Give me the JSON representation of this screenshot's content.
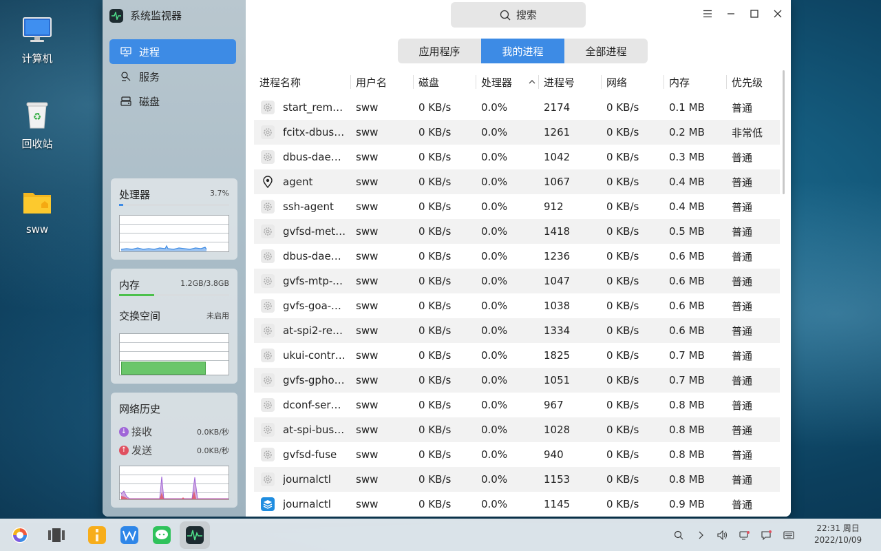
{
  "desktop": {
    "icons": [
      {
        "label": "计算机"
      },
      {
        "label": "回收站"
      },
      {
        "label": "sww"
      }
    ]
  },
  "window": {
    "title": "系统监视器",
    "search_placeholder": "搜索",
    "nav": [
      {
        "label": "进程",
        "active": true
      },
      {
        "label": "服务",
        "active": false
      },
      {
        "label": "磁盘",
        "active": false
      }
    ],
    "cpu_card": {
      "title": "处理器",
      "value": "3.7%",
      "level": 0.037
    },
    "mem_card": {
      "title": "内存",
      "value": "1.2GB/3.8GB",
      "level": 0.32,
      "swap_title": "交换空间",
      "swap_value": "未启用"
    },
    "net_card": {
      "title": "网络历史",
      "recv_label": "接收",
      "recv_value": "0.0KB/秒",
      "send_label": "发送",
      "send_value": "0.0KB/秒"
    },
    "tabs": [
      {
        "label": "应用程序",
        "active": false
      },
      {
        "label": "我的进程",
        "active": true
      },
      {
        "label": "全部进程",
        "active": false
      }
    ],
    "columns": [
      "进程名称",
      "用户名",
      "磁盘",
      "处理器",
      "进程号",
      "网络",
      "内存",
      "优先级"
    ],
    "sort_column": "处理器",
    "processes": [
      {
        "name": "start_remo…",
        "icon": "gear-icon",
        "user": "sww",
        "disk": "0 KB/s",
        "cpu": "0.0%",
        "pid": "2174",
        "net": "0 KB/s",
        "mem": "0.1 MB",
        "priority": "普通"
      },
      {
        "name": "fcitx-dbus-…",
        "icon": "gear-icon",
        "user": "sww",
        "disk": "0 KB/s",
        "cpu": "0.0%",
        "pid": "1261",
        "net": "0 KB/s",
        "mem": "0.2 MB",
        "priority": "非常低"
      },
      {
        "name": "dbus-dae…",
        "icon": "gear-icon",
        "user": "sww",
        "disk": "0 KB/s",
        "cpu": "0.0%",
        "pid": "1042",
        "net": "0 KB/s",
        "mem": "0.3 MB",
        "priority": "普通"
      },
      {
        "name": "agent",
        "icon": "location-pin-icon",
        "user": "sww",
        "disk": "0 KB/s",
        "cpu": "0.0%",
        "pid": "1067",
        "net": "0 KB/s",
        "mem": "0.4 MB",
        "priority": "普通"
      },
      {
        "name": "ssh-agent",
        "icon": "gear-icon",
        "user": "sww",
        "disk": "0 KB/s",
        "cpu": "0.0%",
        "pid": "912",
        "net": "0 KB/s",
        "mem": "0.4 MB",
        "priority": "普通"
      },
      {
        "name": "gvfsd-met…",
        "icon": "gear-icon",
        "user": "sww",
        "disk": "0 KB/s",
        "cpu": "0.0%",
        "pid": "1418",
        "net": "0 KB/s",
        "mem": "0.5 MB",
        "priority": "普通"
      },
      {
        "name": "dbus-dae…",
        "icon": "gear-icon",
        "user": "sww",
        "disk": "0 KB/s",
        "cpu": "0.0%",
        "pid": "1236",
        "net": "0 KB/s",
        "mem": "0.6 MB",
        "priority": "普通"
      },
      {
        "name": "gvfs-mtp-v…",
        "icon": "gear-icon",
        "user": "sww",
        "disk": "0 KB/s",
        "cpu": "0.0%",
        "pid": "1047",
        "net": "0 KB/s",
        "mem": "0.6 MB",
        "priority": "普通"
      },
      {
        "name": "gvfs-goa-v…",
        "icon": "gear-icon",
        "user": "sww",
        "disk": "0 KB/s",
        "cpu": "0.0%",
        "pid": "1038",
        "net": "0 KB/s",
        "mem": "0.6 MB",
        "priority": "普通"
      },
      {
        "name": "at-spi2-reg…",
        "icon": "gear-icon",
        "user": "sww",
        "disk": "0 KB/s",
        "cpu": "0.0%",
        "pid": "1334",
        "net": "0 KB/s",
        "mem": "0.6 MB",
        "priority": "普通"
      },
      {
        "name": "ukui-contr…",
        "icon": "gear-icon",
        "user": "sww",
        "disk": "0 KB/s",
        "cpu": "0.0%",
        "pid": "1825",
        "net": "0 KB/s",
        "mem": "0.7 MB",
        "priority": "普通"
      },
      {
        "name": "gvfs-gphot…",
        "icon": "gear-icon",
        "user": "sww",
        "disk": "0 KB/s",
        "cpu": "0.0%",
        "pid": "1051",
        "net": "0 KB/s",
        "mem": "0.7 MB",
        "priority": "普通"
      },
      {
        "name": "dconf-serv…",
        "icon": "gear-icon",
        "user": "sww",
        "disk": "0 KB/s",
        "cpu": "0.0%",
        "pid": "967",
        "net": "0 KB/s",
        "mem": "0.8 MB",
        "priority": "普通"
      },
      {
        "name": "at-spi-bus-…",
        "icon": "gear-icon",
        "user": "sww",
        "disk": "0 KB/s",
        "cpu": "0.0%",
        "pid": "1028",
        "net": "0 KB/s",
        "mem": "0.8 MB",
        "priority": "普通"
      },
      {
        "name": "gvfsd-fuse",
        "icon": "gear-icon",
        "user": "sww",
        "disk": "0 KB/s",
        "cpu": "0.0%",
        "pid": "940",
        "net": "0 KB/s",
        "mem": "0.8 MB",
        "priority": "普通"
      },
      {
        "name": "journalctl",
        "icon": "gear-icon",
        "user": "sww",
        "disk": "0 KB/s",
        "cpu": "0.0%",
        "pid": "1153",
        "net": "0 KB/s",
        "mem": "0.8 MB",
        "priority": "普通"
      },
      {
        "name": "journalctl",
        "icon": "blue-layers-icon",
        "user": "sww",
        "disk": "0 KB/s",
        "cpu": "0.0%",
        "pid": "1145",
        "net": "0 KB/s",
        "mem": "0.9 MB",
        "priority": "普通"
      }
    ]
  },
  "taskbar": {
    "apps": [
      "start-menu-icon",
      "multitask-view-icon",
      "file-manager-icon",
      "wps-icon",
      "wechat-icon",
      "system-monitor-icon"
    ],
    "tray": [
      "search-icon",
      "chevron-right-icon",
      "volume-icon",
      "network-icon",
      "notification-icon",
      "keyboard-icon"
    ],
    "time": "22:31 周日",
    "date": "2022/10/09"
  },
  "colors": {
    "accent": "#3d8be5",
    "cpu_line": "#3d8be5",
    "mem_bar": "#4cc04c",
    "recv": "#a066d8",
    "send": "#e05060"
  }
}
